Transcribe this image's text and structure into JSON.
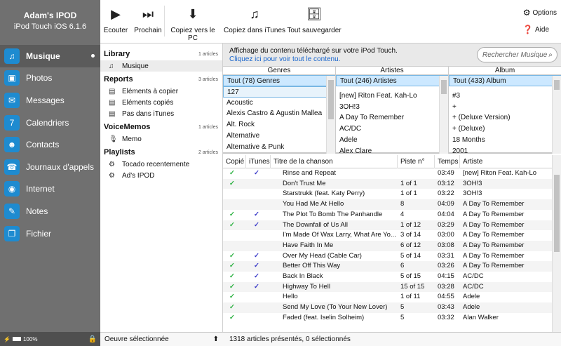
{
  "device": {
    "name": "Adam's IPOD",
    "model": "iPod Touch iOS 6.1.6",
    "battery": "100%"
  },
  "nav": [
    {
      "label": "Musique",
      "icon": "music-icon",
      "active": true
    },
    {
      "label": "Photos",
      "icon": "photos-icon"
    },
    {
      "label": "Messages",
      "icon": "messages-icon"
    },
    {
      "label": "Calendriers",
      "icon": "calendar-icon"
    },
    {
      "label": "Contacts",
      "icon": "contacts-icon"
    },
    {
      "label": "Journaux d'appels",
      "icon": "phone-icon"
    },
    {
      "label": "Internet",
      "icon": "internet-icon"
    },
    {
      "label": "Notes",
      "icon": "notes-icon"
    },
    {
      "label": "Fichier",
      "icon": "file-icon"
    }
  ],
  "toolbar": {
    "buttons": [
      {
        "label": "Ecouter",
        "icon": "play-icon"
      },
      {
        "label": "Prochain",
        "icon": "next-icon"
      },
      {
        "label": "Copiez vers le PC",
        "icon": "download-icon"
      },
      {
        "label": "Copiez dans iTunes",
        "icon": "music-note-icon"
      },
      {
        "label": "Tout sauvegarder",
        "icon": "database-icon"
      }
    ],
    "options": "Options",
    "help": "Aide"
  },
  "library": {
    "sections": [
      {
        "title": "Library",
        "count": "1 articles",
        "items": [
          {
            "label": "Musique",
            "icon": "music-note-icon",
            "selected": true
          }
        ]
      },
      {
        "title": "Reports",
        "count": "3 articles",
        "items": [
          {
            "label": "Eléments à copier",
            "icon": "document-icon"
          },
          {
            "label": "Eléments copiés",
            "icon": "document-icon"
          },
          {
            "label": "Pas dans iTunes",
            "icon": "document-icon"
          }
        ]
      },
      {
        "title": "VoiceMemos",
        "count": "1 articles",
        "items": [
          {
            "label": "Memo",
            "icon": "microphone-icon"
          }
        ]
      },
      {
        "title": "Playlists",
        "count": "2 articles",
        "items": [
          {
            "label": "Tocado recentemente",
            "icon": "gear-icon"
          },
          {
            "label": "Ad's IPOD",
            "icon": "gear-icon"
          }
        ]
      }
    ],
    "status": "Oeuvre sélectionnée"
  },
  "info": {
    "line": "Affichage du contenu téléchargé sur votre iPod Touch.",
    "link": "Cliquez ici pour voir tout le contenu.",
    "search_placeholder": "Rechercher Musique"
  },
  "browser": {
    "genres": {
      "header": "Genres",
      "items": [
        "Tout (78) Genres",
        "127",
        "Acoustic",
        "Alexis Castro & Agustin Mallea",
        "Alt. Rock",
        "Alternative",
        "Alternative & Punk"
      ]
    },
    "artists": {
      "header": "Artistes",
      "items": [
        "Tout (246) Artistes",
        "[new] Riton Feat. Kah-Lo",
        "3OH!3",
        "A Day To Remember",
        "AC/DC",
        "Adele",
        "Alex Clare"
      ]
    },
    "albums": {
      "header": "Album",
      "items": [
        "Tout (433) Album",
        "#3",
        "+",
        "+ (Deluxe Version)",
        "+ (Deluxe)",
        "18 Months",
        "2001"
      ]
    }
  },
  "table": {
    "headers": {
      "copied": "Copié",
      "itunes": "iTunes",
      "title": "Titre de la chanson",
      "track": "Piste n°",
      "time": "Temps",
      "artist": "Artiste"
    },
    "rows": [
      {
        "copied": true,
        "itunes": true,
        "title": "Rinse and Repeat",
        "track": "",
        "time": "03:49",
        "artist": "[new] Riton Feat. Kah-Lo"
      },
      {
        "copied": true,
        "itunes": false,
        "title": "Don't Trust Me",
        "track": "1 of 1",
        "time": "03:12",
        "artist": "3OH!3"
      },
      {
        "copied": false,
        "itunes": false,
        "title": "Starstrukk (feat. Katy Perry)",
        "track": "1 of 1",
        "time": "03:22",
        "artist": "3OH!3"
      },
      {
        "copied": false,
        "itunes": false,
        "title": "You Had Me At Hello",
        "track": "8",
        "time": "04:09",
        "artist": "A Day To Remember"
      },
      {
        "copied": true,
        "itunes": true,
        "title": "The Plot To Bomb The Panhandle",
        "track": "4",
        "time": "04:04",
        "artist": "A Day To Remember"
      },
      {
        "copied": true,
        "itunes": true,
        "title": "The Downfall of Us All",
        "track": "1 of 12",
        "time": "03:29",
        "artist": "A Day To Remember"
      },
      {
        "copied": false,
        "itunes": false,
        "title": "I'm Made Of Wax Larry, What Are Yo...",
        "track": "3 of 14",
        "time": "03:00",
        "artist": "A Day To Remember"
      },
      {
        "copied": false,
        "itunes": false,
        "title": "Have Faith In Me",
        "track": "6 of 12",
        "time": "03:08",
        "artist": "A Day To Remember"
      },
      {
        "copied": true,
        "itunes": true,
        "title": "Over My Head (Cable Car)",
        "track": "5 of 14",
        "time": "03:31",
        "artist": "A Day To Remember"
      },
      {
        "copied": true,
        "itunes": true,
        "title": "Better Off This Way",
        "track": "6",
        "time": "03:26",
        "artist": "A Day To Remember"
      },
      {
        "copied": true,
        "itunes": true,
        "title": "Back In Black",
        "track": "5 of 15",
        "time": "04:15",
        "artist": "AC/DC"
      },
      {
        "copied": true,
        "itunes": true,
        "title": "Highway To Hell",
        "track": "15 of 15",
        "time": "03:28",
        "artist": "AC/DC"
      },
      {
        "copied": true,
        "itunes": false,
        "title": "Hello",
        "track": "1 of 11",
        "time": "04:55",
        "artist": "Adele"
      },
      {
        "copied": true,
        "itunes": false,
        "title": "Send My Love (To Your New Lover)",
        "track": "5",
        "time": "03:43",
        "artist": "Adele"
      },
      {
        "copied": true,
        "itunes": false,
        "title": "Faded (feat. Iselin Solheim)",
        "track": "5",
        "time": "03:32",
        "artist": "Alan Walker"
      }
    ]
  },
  "status": "1318 articles présentés, 0 sélectionnés"
}
